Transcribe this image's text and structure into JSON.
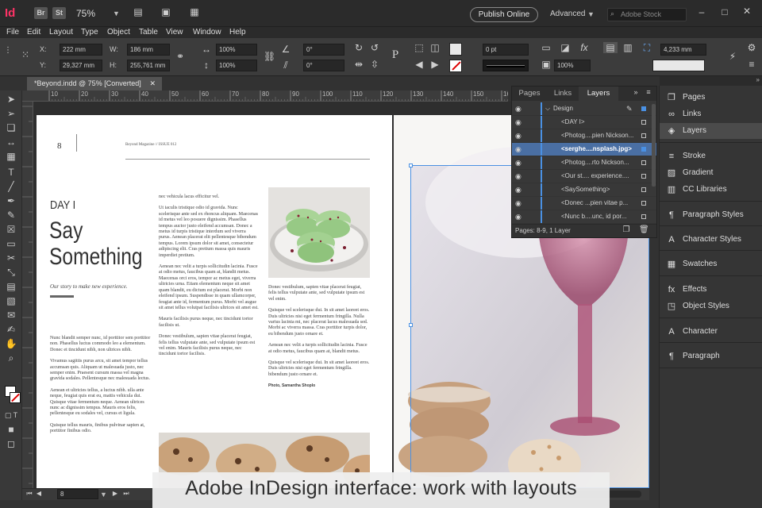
{
  "app": {
    "logo": "Id",
    "bridge": "Br",
    "stock": "St",
    "zoom": "75%",
    "publish": "Publish Online",
    "workspace": "Advanced",
    "search_placeholder": "Adobe Stock"
  },
  "menu": [
    "File",
    "Edit",
    "Layout",
    "Type",
    "Object",
    "Table",
    "View",
    "Window",
    "Help"
  ],
  "control": {
    "x_label": "X:",
    "x": "222 mm",
    "y_label": "Y:",
    "y": "29,327 mm",
    "w_label": "W:",
    "w": "186 mm",
    "h_label": "H:",
    "h": "255,761 mm",
    "scale_x": "100%",
    "scale_y": "100%",
    "rotate": "0°",
    "shear": "0°",
    "stroke_weight": "0 pt",
    "opacity": "100%",
    "offset": "4,233 mm"
  },
  "document_tab": {
    "title": "*Beyond.indd @ 75% [Converted]"
  },
  "ruler": [
    "10",
    "20",
    "30",
    "40",
    "50",
    "60",
    "70",
    "80",
    "90",
    "100",
    "110",
    "120",
    "130",
    "140",
    "150",
    "160"
  ],
  "page_left": {
    "page_number": "8",
    "header": "Beyond Magazine  //  ISSUE 012",
    "day": "DAY I",
    "title_line1": "Say",
    "title_line2": "Something",
    "subtitle": "Our story to make new experience.",
    "col1": [
      "Nunc blandit semper nunc, id porttitor sem porttitor non. Phasellus luctus commodo leo a elementum. Donec et tincidunt nibh, non ultrices nibh.",
      "Vivamus sagittis purus arcu, sit amet tempor tellus accumsan quis. Aliquam ut malesuada justo, nec semper enim. Praesent cursum massa vel magna gravida sodales. Pellentesque nec malesuada lectus.",
      "Aenean et ultricies tellus, a luctus nibh. ulla ante neque, feugiat quis erat eu, mattis vehicula dui. Quisque vitae fermentum neque. Aenean ultrices nunc ac dignissim tempus. Mauris eros felis, pellentesque eu sodales vel, cursus et ligula.",
      "Quisque tellus mauris, finibus pulvinar sapien at, porttitor finibus odio."
    ],
    "col2": [
      "nec vehicula lacus efficitur vel.",
      "Ut iaculis tristique odio id gravida. Nunc scelerisque ante sed ex rhoncus aliquam. Maecenas id metus vel leo posuere dignissim. Phasellus tempus auctor justo eleifend accumsan. Donec a metus id turpis tristique interdum sed viverra purus. Aenean placerat elit pellentesque bibendum tempus. Lorem ipsum dolor sit amet, consectetur adipiscing elit. Cras pretium massa quis mauris imperdiet pretium.",
      "Aenean nec velit a turpis sollicitudin lacinia. Fusce at odio metus, faucibus quam at, blandit metus. Maecenas orci eros, tempor ac metus eget, viverra ultricies urna. Etiam elementum neque sit amet quam blandit, eu dictum est placerat. Morbi non eleifend ipsum. Suspendisse in quam ullamcorper, feugiat ante id, fermentum purus. Morbi vel augue sit amet tellus volutpat facilisis ultrices sit amet est.",
      "Mauris facilisis purus neque, nec tincidunt tortor facilisis ut.",
      "Donec vestibulum, sapien vitae placerat feugiat, felis tellus vulputate ante, sed vulputate ipsum est vel enim. Mauris facilisis purus neque, nec tincidunt tortor facilisis."
    ],
    "col3": [
      "Donec vestibulum, sapien vitae placerat feugiat, felis tellus vulputate ante, sed vulputate ipsum est vel enim.",
      "Quisque vel scelerisque dui. In sit amet laoreet eros. Duis ultricies nisi eget fermentum fringilla. Nulla varius lacinia mi, nec placerat lacus malesuada sed. Morbi ac viverra massa. Cras porttitor turpis dolor, eu bibendum justo ornare et.",
      "Aenean nec velit a turpis sollicitudin lacinia. Fusce at odio metus, faucibus quam at, blandit metus.",
      "Quisque vel scelerisque dui. In sit amet laoreet eros. Duis ultricies nisi eget fermentum fringilla. bibendum justo ornare et."
    ],
    "photo_credit": "Photo, Samantha Shoplo"
  },
  "layers_panel": {
    "tabs": [
      "Pages",
      "Links",
      "Layers"
    ],
    "rows": [
      {
        "label": "Design",
        "level": 0,
        "selected": false
      },
      {
        "label": "<DAY I>",
        "level": 1,
        "selected": false
      },
      {
        "label": "<Photog....pien Nickson...",
        "level": 1,
        "selected": false
      },
      {
        "label": "<serghe....nsplash.jpg>",
        "level": 1,
        "selected": true
      },
      {
        "label": "<Photog....rto Nickson...",
        "level": 1,
        "selected": false
      },
      {
        "label": "<Our st.... experience....",
        "level": 1,
        "selected": false
      },
      {
        "label": "<SaySomething>",
        "level": 1,
        "selected": false
      },
      {
        "label": "<Donec ...pien vitae p...",
        "level": 1,
        "selected": false
      },
      {
        "label": "<Nunc b....unc, id por...",
        "level": 1,
        "selected": false
      }
    ],
    "footer": "Pages: 8-9, 1 Layer",
    "layer_color": "#4a90e2"
  },
  "dock": [
    {
      "icon": "pages-icon",
      "glyph": "❐",
      "label": "Pages",
      "active": false
    },
    {
      "icon": "links-icon",
      "glyph": "∞",
      "label": "Links",
      "active": false
    },
    {
      "icon": "layers-icon",
      "glyph": "◈",
      "label": "Layers",
      "active": true
    },
    {
      "icon": "stroke-icon",
      "glyph": "≡",
      "label": "Stroke",
      "active": false
    },
    {
      "icon": "gradient-icon",
      "glyph": "▨",
      "label": "Gradient",
      "active": false
    },
    {
      "icon": "cc-libraries-icon",
      "glyph": "▥",
      "label": "CC Libraries",
      "active": false
    },
    {
      "icon": "paragraph-styles-icon",
      "glyph": "¶",
      "label": "Paragraph Styles",
      "active": false
    },
    {
      "icon": "character-styles-icon",
      "glyph": "A",
      "label": "Character Styles",
      "active": false
    },
    {
      "icon": "swatches-icon",
      "glyph": "▦",
      "label": "Swatches",
      "active": false
    },
    {
      "icon": "effects-icon",
      "glyph": "fx",
      "label": "Effects",
      "active": false
    },
    {
      "icon": "object-styles-icon",
      "glyph": "◳",
      "label": "Object Styles",
      "active": false
    },
    {
      "icon": "character-icon",
      "glyph": "A",
      "label": "Character",
      "active": false
    },
    {
      "icon": "paragraph-icon",
      "glyph": "¶",
      "label": "Paragraph",
      "active": false
    }
  ],
  "status": {
    "page": "8"
  },
  "caption": "Adobe InDesign interface: work with layouts",
  "colors": {
    "accent": "#4a90e2",
    "logo": "#ff3366",
    "macaron": "#9fcf8a",
    "wine_glass": "#b5637f"
  }
}
